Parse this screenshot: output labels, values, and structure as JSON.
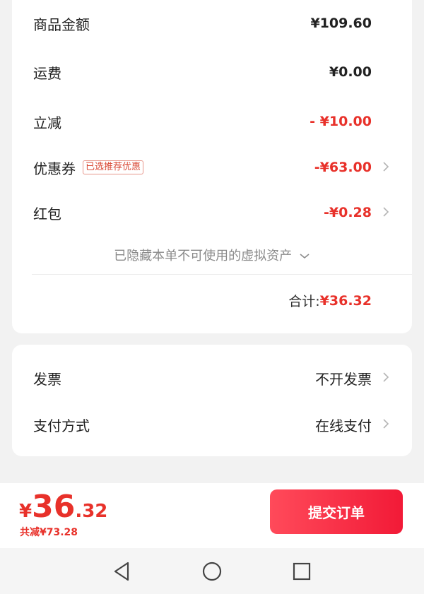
{
  "price_card": {
    "rows": [
      {
        "label": "商品金额",
        "value": "¥109.60"
      },
      {
        "label": "运费",
        "value": "¥0.00"
      },
      {
        "label": "立减",
        "value": "- ¥10.00"
      },
      {
        "label": "优惠券",
        "tag": "已选推荐优惠",
        "value": "-¥63.00"
      },
      {
        "label": "红包",
        "value": "-¥0.28"
      }
    ],
    "hidden_note": "已隐藏本单不可使用的虚拟资产",
    "total_label": "合计:",
    "total_value": "¥36.32"
  },
  "invoice_card": {
    "rows": [
      {
        "label": "发票",
        "value": "不开发票"
      },
      {
        "label": "支付方式",
        "value": "在线支付"
      }
    ]
  },
  "bottom_bar": {
    "currency": "¥",
    "price_int": "36",
    "price_dec": ".32",
    "saved_text": "共减¥73.28",
    "submit_label": "提交订单"
  },
  "colors": {
    "accent_red": "#e8312a",
    "button_gradient_start": "#ff4a5a",
    "button_gradient_end": "#f21a37",
    "background": "#f2f2f2"
  },
  "icons": {
    "row_chevron": "chevron-right-icon",
    "note_chevron": "chevron-down-icon",
    "nav": [
      "back-triangle-icon",
      "home-circle-icon",
      "recent-square-icon"
    ]
  }
}
